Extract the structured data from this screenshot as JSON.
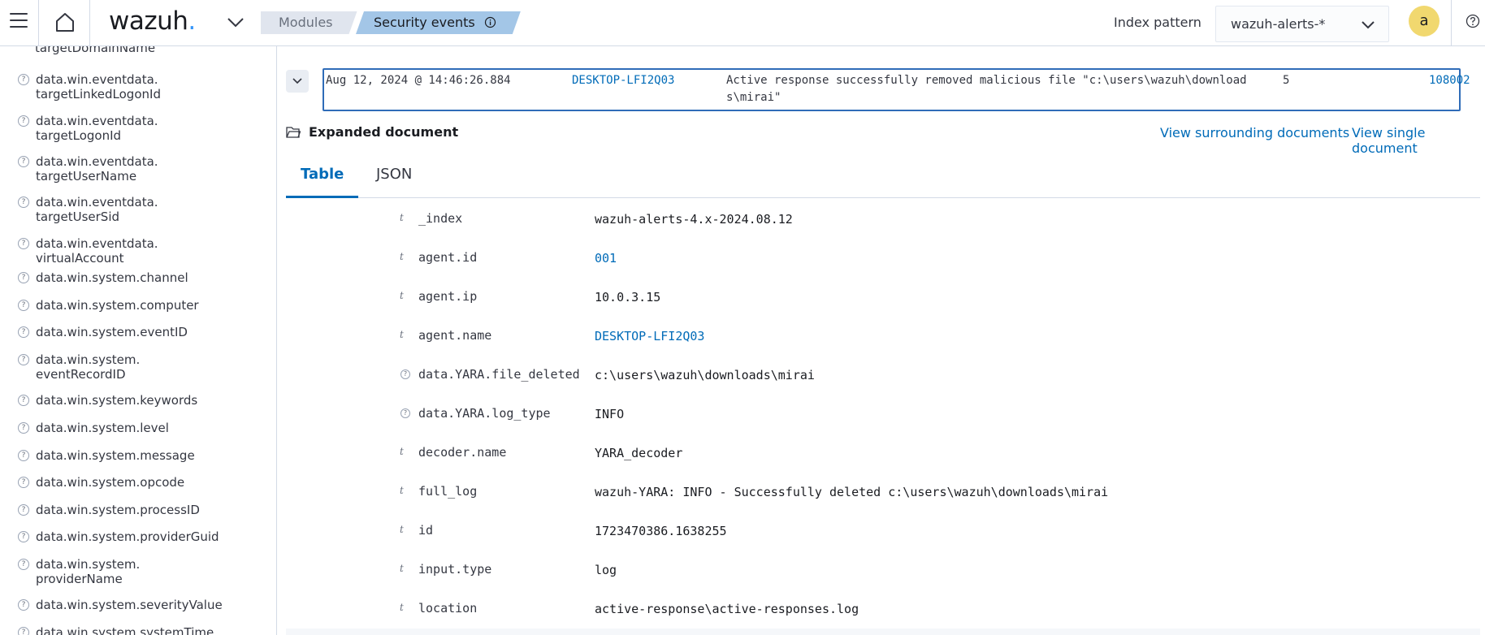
{
  "header": {
    "logo_text": "wazuh",
    "logo_dot": ".",
    "breadcrumbs": [
      "Modules",
      "Security events"
    ],
    "index_pattern_label": "Index pattern",
    "index_pattern_value": "wazuh-alerts-*",
    "avatar_letter": "a",
    "colors": {
      "accent": "#006bb8",
      "logo_dot": "#3595f9",
      "avatar": "#f1d86f"
    }
  },
  "sidebar": {
    "partial_top": "targetDomainName",
    "fields": [
      "data.win.eventdata.\ntargetLinkedLogonId",
      "data.win.eventdata.\ntargetLogonId",
      "data.win.eventdata.\ntargetUserName",
      "data.win.eventdata.\ntargetUserSid",
      "data.win.eventdata.\nvirtualAccount",
      "data.win.system.channel",
      "data.win.system.computer",
      "data.win.system.eventID",
      "data.win.system.\neventRecordID",
      "data.win.system.keywords",
      "data.win.system.level",
      "data.win.system.message",
      "data.win.system.opcode",
      "data.win.system.processID",
      "data.win.system.providerGuid",
      "data.win.system.\nproviderName",
      "data.win.system.severityValue",
      "data.win.system.systemTime"
    ]
  },
  "event_row": {
    "time": "Aug 12, 2024 @ 14:46:26.884",
    "agent": "DESKTOP-LFI2Q03",
    "description": "Active response successfully removed malicious file \"c:\\users\\wazuh\\download\ns\\mirai\"",
    "level": "5",
    "rule_id": "108002"
  },
  "expanded": {
    "title": "Expanded document",
    "surrounding_link": "View surrounding documents",
    "single_link": "View single document"
  },
  "tabs": [
    "Table",
    "JSON"
  ],
  "document": [
    {
      "type": "t",
      "key": "_index",
      "value": "wazuh-alerts-4.x-2024.08.12",
      "link": false
    },
    {
      "type": "t",
      "key": "agent.id",
      "value": "001",
      "link": true
    },
    {
      "type": "t",
      "key": "agent.ip",
      "value": "10.0.3.15",
      "link": false
    },
    {
      "type": "t",
      "key": "agent.name",
      "value": "DESKTOP-LFI2Q03",
      "link": true
    },
    {
      "type": "?",
      "key": "data.YARA.file_deleted",
      "value": "c:\\users\\wazuh\\downloads\\mirai",
      "link": false
    },
    {
      "type": "?",
      "key": "data.YARA.log_type",
      "value": "INFO",
      "link": false
    },
    {
      "type": "t",
      "key": "decoder.name",
      "value": "YARA_decoder",
      "link": false
    },
    {
      "type": "t",
      "key": "full_log",
      "value": "wazuh-YARA: INFO - Successfully deleted c:\\users\\wazuh\\downloads\\mirai",
      "link": false
    },
    {
      "type": "t",
      "key": "id",
      "value": "1723470386.1638255",
      "link": false
    },
    {
      "type": "t",
      "key": "input.type",
      "value": "log",
      "link": false
    },
    {
      "type": "t",
      "key": "location",
      "value": "active-response\\active-responses.log",
      "link": false
    }
  ]
}
